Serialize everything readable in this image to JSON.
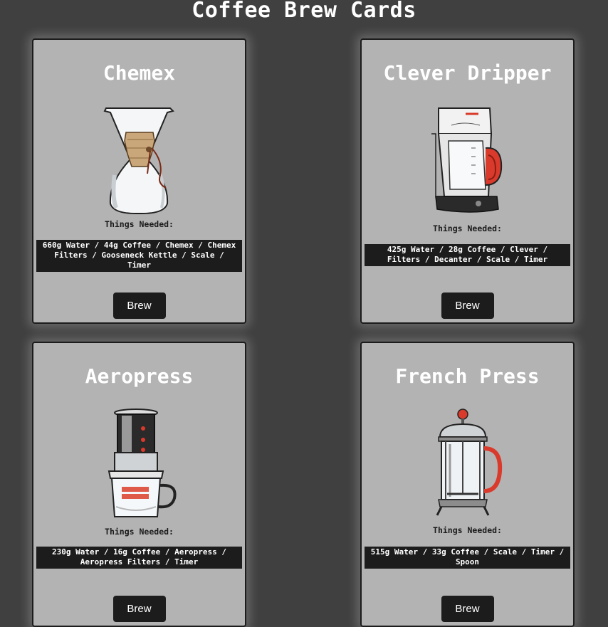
{
  "page": {
    "title": "Coffee Brew Cards"
  },
  "cards": [
    {
      "title": "Chemex",
      "illustration": "chemex-illustration",
      "needed_label": "Things Needed:",
      "needed": "660g Water / 44g Coffee / Chemex / Chemex Filters / Gooseneck Kettle / Scale / Timer",
      "button": "Brew"
    },
    {
      "title": "Clever Dripper",
      "illustration": "clever-dripper-illustration",
      "needed_label": "Things Needed:",
      "needed": "425g Water / 28g Coffee / Clever / Filters / Decanter / Scale / Timer",
      "button": "Brew"
    },
    {
      "title": "Aeropress",
      "illustration": "aeropress-illustration",
      "needed_label": "Things Needed:",
      "needed": "230g Water / 16g Coffee / Aeropress / Aeropress Filters / Timer",
      "button": "Brew"
    },
    {
      "title": "French Press",
      "illustration": "french-press-illustration",
      "needed_label": "Things Needed:",
      "needed": "515g Water / 33g Coffee / Scale / Timer / Spoon",
      "button": "Brew"
    }
  ],
  "colors": {
    "background": "#404040",
    "card": "#b3b3b3",
    "dark": "#1c1c1c",
    "accent_red": "#d93a2b"
  }
}
